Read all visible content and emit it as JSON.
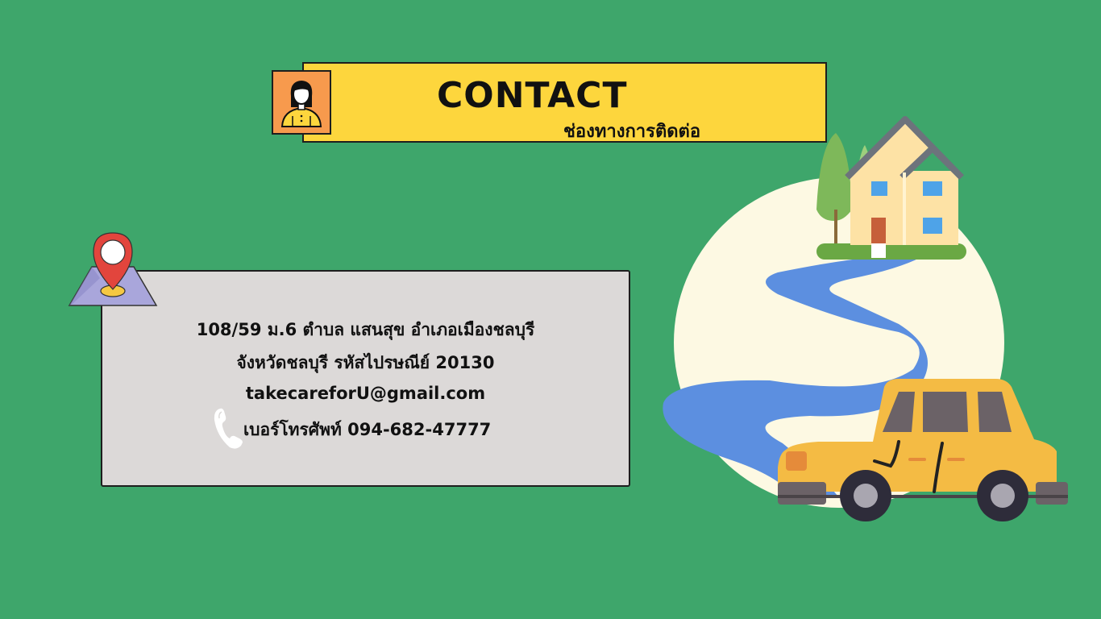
{
  "header": {
    "title": "CONTACT",
    "subtitle": "ช่องทางการติดต่อ"
  },
  "contact": {
    "address_line1": "108/59  ม.6  ตำบล แสนสุข  อำเภอเมืองชลบุรี",
    "address_line2": "จังหวัดชลบุรี  รหัสไปรษณีย์ 20130",
    "email": "takecareforU@gmail.com",
    "phone": "เบอร์โทรศัพท์ 094-682-47777"
  },
  "icons": {
    "avatar": "woman-avatar-icon",
    "location": "location-pin-icon",
    "phone": "phone-icon",
    "illustration": "house-road-car-illustration"
  },
  "colors": {
    "background": "#3ea66b",
    "header": "#fdd63d",
    "avatar_bg": "#f79a4d",
    "info_box": "#dcd9d8"
  }
}
